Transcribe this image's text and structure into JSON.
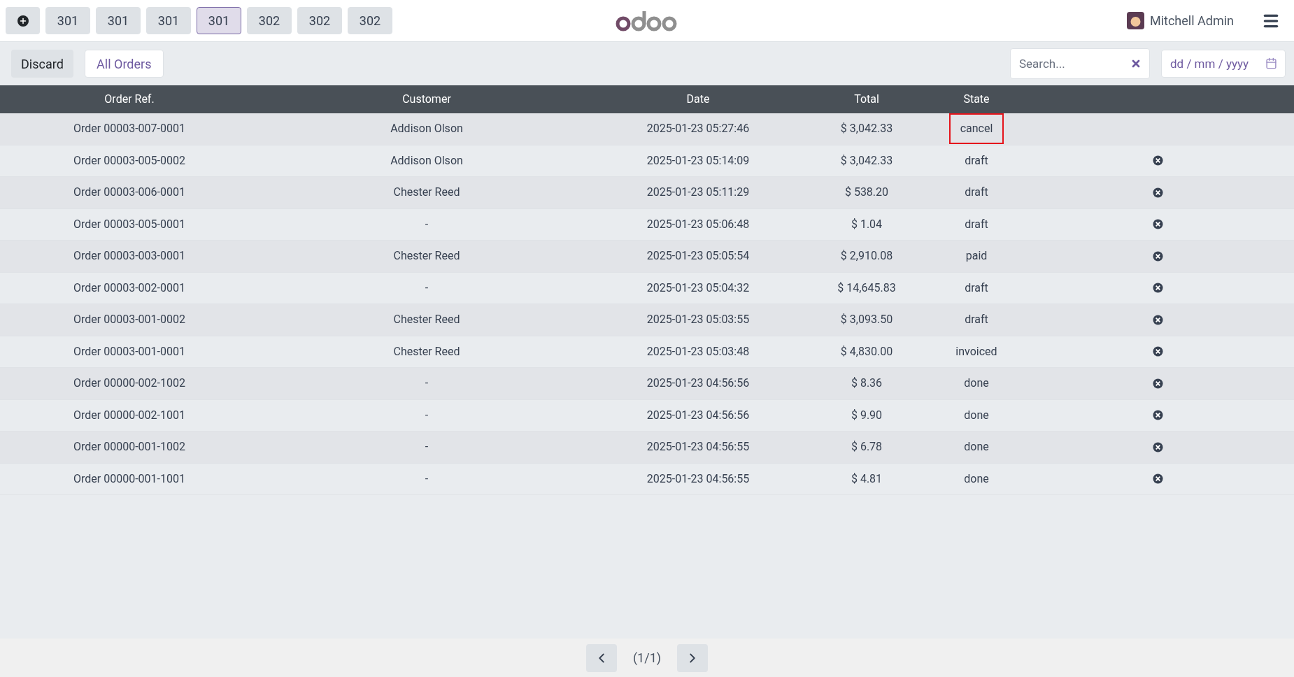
{
  "top_bar": {
    "tables": [
      {
        "label": "301",
        "selected": false
      },
      {
        "label": "301",
        "selected": false
      },
      {
        "label": "301",
        "selected": false
      },
      {
        "label": "301",
        "selected": true
      },
      {
        "label": "302",
        "selected": false
      },
      {
        "label": "302",
        "selected": false
      },
      {
        "label": "302",
        "selected": false
      }
    ],
    "user": "Mitchell Admin"
  },
  "control_bar": {
    "discard": "Discard",
    "filter": "All Orders",
    "search": {
      "placeholder": "Search..."
    },
    "date": {
      "placeholder": "dd / mm / yyyy"
    }
  },
  "table": {
    "columns": [
      "Order Ref.",
      "Customer",
      "Date",
      "Total",
      "State"
    ],
    "rows": [
      {
        "ref": "Order 00003-007-0001",
        "customer": "Addison Olson",
        "date": "2025-01-23 05:27:46",
        "total": "$ 3,042.33",
        "state": "cancel",
        "highlighted": true,
        "deletable": false
      },
      {
        "ref": "Order 00003-005-0002",
        "customer": "Addison Olson",
        "date": "2025-01-23 05:14:09",
        "total": "$ 3,042.33",
        "state": "draft",
        "highlighted": false,
        "deletable": true
      },
      {
        "ref": "Order 00003-006-0001",
        "customer": "Chester Reed",
        "date": "2025-01-23 05:11:29",
        "total": "$ 538.20",
        "state": "draft",
        "highlighted": false,
        "deletable": true
      },
      {
        "ref": "Order 00003-005-0001",
        "customer": "-",
        "date": "2025-01-23 05:06:48",
        "total": "$ 1.04",
        "state": "draft",
        "highlighted": false,
        "deletable": true
      },
      {
        "ref": "Order 00003-003-0001",
        "customer": "Chester Reed",
        "date": "2025-01-23 05:05:54",
        "total": "$ 2,910.08",
        "state": "paid",
        "highlighted": false,
        "deletable": true
      },
      {
        "ref": "Order 00003-002-0001",
        "customer": "-",
        "date": "2025-01-23 05:04:32",
        "total": "$ 14,645.83",
        "state": "draft",
        "highlighted": false,
        "deletable": true
      },
      {
        "ref": "Order 00003-001-0002",
        "customer": "Chester Reed",
        "date": "2025-01-23 05:03:55",
        "total": "$ 3,093.50",
        "state": "draft",
        "highlighted": false,
        "deletable": true
      },
      {
        "ref": "Order 00003-001-0001",
        "customer": "Chester Reed",
        "date": "2025-01-23 05:03:48",
        "total": "$ 4,830.00",
        "state": "invoiced",
        "highlighted": false,
        "deletable": true
      },
      {
        "ref": "Order 00000-002-1002",
        "customer": "-",
        "date": "2025-01-23 04:56:56",
        "total": "$ 8.36",
        "state": "done",
        "highlighted": false,
        "deletable": true
      },
      {
        "ref": "Order 00000-002-1001",
        "customer": "-",
        "date": "2025-01-23 04:56:56",
        "total": "$ 9.90",
        "state": "done",
        "highlighted": false,
        "deletable": true
      },
      {
        "ref": "Order 00000-001-1002",
        "customer": "-",
        "date": "2025-01-23 04:56:55",
        "total": "$ 6.78",
        "state": "done",
        "highlighted": false,
        "deletable": true
      },
      {
        "ref": "Order 00000-001-1001",
        "customer": "-",
        "date": "2025-01-23 04:56:55",
        "total": "$ 4.81",
        "state": "done",
        "highlighted": false,
        "deletable": true
      }
    ]
  },
  "pager": {
    "label": "(1/1)"
  }
}
